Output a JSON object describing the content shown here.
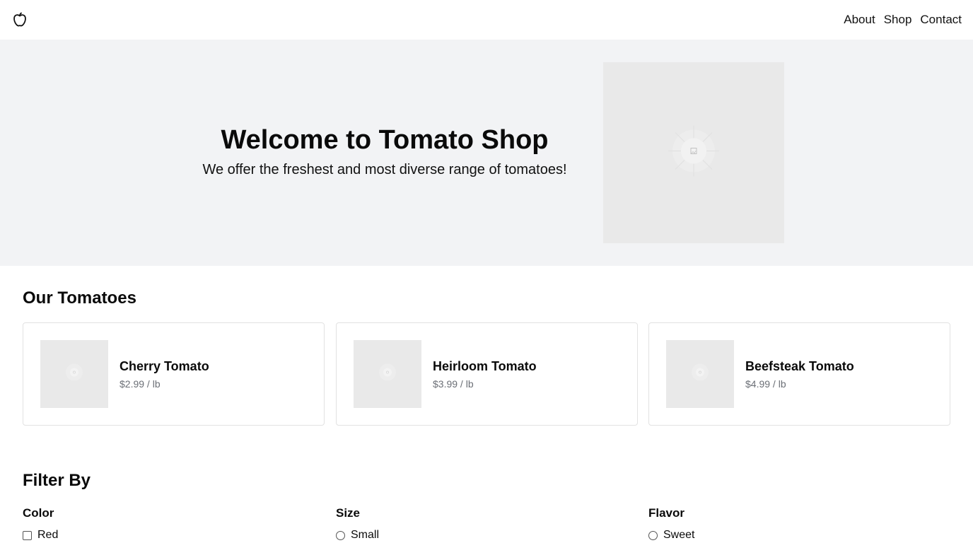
{
  "header": {
    "logo_icon": "apple-icon",
    "nav": [
      "About",
      "Shop",
      "Contact"
    ]
  },
  "hero": {
    "title": "Welcome to Tomato Shop",
    "subtitle": "We offer the freshest and most diverse range of tomatoes!",
    "image_icon": "image-placeholder-icon"
  },
  "products": {
    "title": "Our Tomatoes",
    "items": [
      {
        "name": "Cherry Tomato",
        "price": "$2.99 / lb"
      },
      {
        "name": "Heirloom Tomato",
        "price": "$3.99 / lb"
      },
      {
        "name": "Beefsteak Tomato",
        "price": "$4.99 / lb"
      }
    ]
  },
  "filters": {
    "title": "Filter By",
    "groups": [
      {
        "label": "Color",
        "control": "checkbox",
        "options": [
          "Red"
        ]
      },
      {
        "label": "Size",
        "control": "radio",
        "options": [
          "Small"
        ]
      },
      {
        "label": "Flavor",
        "control": "radio",
        "options": [
          "Sweet"
        ]
      }
    ]
  },
  "colors": {
    "hero_bg": "#f2f3f5",
    "placeholder_bg": "#e9e9e9",
    "price_text": "#6b6f76",
    "card_border": "#e2e2e2"
  }
}
